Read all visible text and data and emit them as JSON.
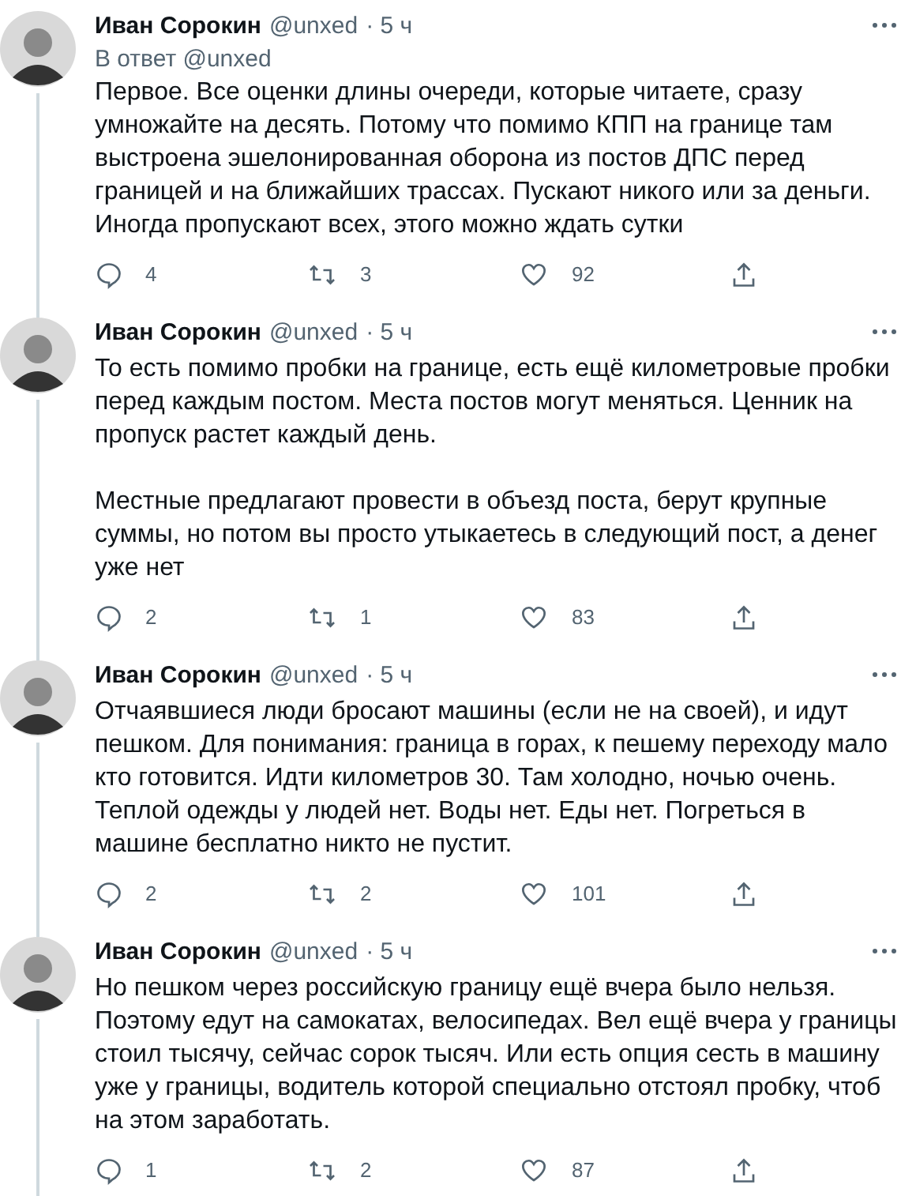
{
  "tweets": [
    {
      "name": "Иван Сорокин",
      "handle": "@unxed",
      "time": "· 5 ч",
      "reply_to": "В ответ @unxed",
      "paragraphs": [
        "Первое. Все оценки длины очереди, которые читаете, сразу умножайте на десять. Потому что помимо КПП на границе там выстроена эшелонированная оборона из постов ДПС перед границей и на ближайших трассах. Пускают никого или за деньги. Иногда пропускают всех, этого можно ждать сутки"
      ],
      "replies": "4",
      "retweets": "3",
      "likes": "92"
    },
    {
      "name": "Иван Сорокин",
      "handle": "@unxed",
      "time": "· 5 ч",
      "paragraphs": [
        "То есть помимо пробки на границе, есть ещё километровые пробки перед каждым постом. Места постов могут меняться. Ценник на пропуск растет каждый день.",
        "Местные предлагают провести в объезд поста, берут крупные суммы, но потом вы просто утыкаетесь в следующий пост, а денег уже нет"
      ],
      "replies": "2",
      "retweets": "1",
      "likes": "83"
    },
    {
      "name": "Иван Сорокин",
      "handle": "@unxed",
      "time": "· 5 ч",
      "paragraphs": [
        "Отчаявшиеся люди бросают машины (если не на своей), и идут пешком. Для понимания: граница в горах, к пешему переходу мало кто готовится. Идти километров 30. Там холодно, ночью очень. Теплой одежды у людей нет. Воды нет. Еды нет. Погреться в машине бесплатно никто не пустит."
      ],
      "replies": "2",
      "retweets": "2",
      "likes": "101"
    },
    {
      "name": "Иван Сорокин",
      "handle": "@unxed",
      "time": "· 5 ч",
      "paragraphs": [
        "Но пешком через российскую границу ещё вчера было нельзя. Поэтому едут на самокатах, велосипедах. Вел ещё вчера у границы стоил тысячу, сейчас сорок тысяч. Или есть опция сесть в машину уже у границы, водитель которой специально отстоял пробку, чтоб на этом заработать."
      ],
      "replies": "1",
      "retweets": "2",
      "likes": "87"
    }
  ]
}
